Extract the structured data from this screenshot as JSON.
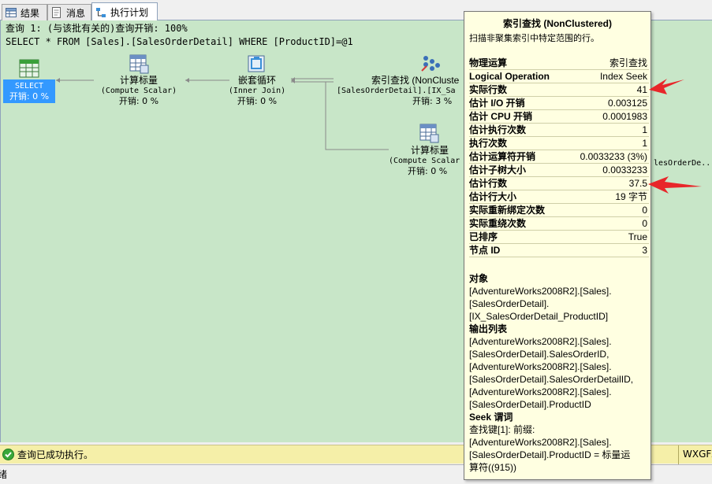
{
  "tabs": [
    {
      "label": "结果",
      "icon": "grid-icon"
    },
    {
      "label": "消息",
      "icon": "message-icon"
    },
    {
      "label": "执行计划",
      "icon": "plan-icon"
    }
  ],
  "query": {
    "header": "查询 1: (与该批有关的)查询开销: 100%",
    "sql": "SELECT * FROM [Sales].[SalesOrderDetail] WHERE [ProductID]=@1"
  },
  "plan": {
    "select": {
      "label": "SELECT",
      "cost": "开销: 0 %"
    },
    "compute1": {
      "name": "计算标量",
      "sub": "(Compute Scalar)",
      "cost": "开销: 0 %"
    },
    "nested": {
      "name": "嵌套循环",
      "sub": "(Inner Join)",
      "cost": "开销: 0 %"
    },
    "seek": {
      "name": "索引查找 (NonCluste",
      "sub": "[SalesOrderDetail].[IX_Sa",
      "cost": "开销: 3 %"
    },
    "compute2": {
      "name": "计算标量",
      "sub": "(Compute Scalar",
      "cost": "开销: 0 %"
    },
    "right_frag": "lesOrderDe..."
  },
  "tooltip": {
    "title": "索引查找 (NonClustered)",
    "description": "扫描非聚集索引中特定范围的行。",
    "rows": [
      {
        "label": "物理运算",
        "value": "索引查找"
      },
      {
        "label": "Logical Operation",
        "value": "Index Seek"
      },
      {
        "label": "实际行数",
        "value": "41"
      },
      {
        "label": "估计 I/O 开销",
        "value": "0.003125"
      },
      {
        "label": "估计 CPU 开销",
        "value": "0.0001983"
      },
      {
        "label": "估计执行次数",
        "value": "1"
      },
      {
        "label": "执行次数",
        "value": "1"
      },
      {
        "label": "估计运算符开销",
        "value": "0.0033233 (3%)"
      },
      {
        "label": "估计子树大小",
        "value": "0.0033233"
      },
      {
        "label": "估计行数",
        "value": "37.5"
      },
      {
        "label": "估计行大小",
        "value": "19 字节"
      },
      {
        "label": "实际重新绑定次数",
        "value": "0"
      },
      {
        "label": "实际重绕次数",
        "value": "0"
      },
      {
        "label": "已排序",
        "value": "True"
      },
      {
        "label": "节点 ID",
        "value": "3"
      }
    ],
    "object": {
      "heading": "对象",
      "lines": [
        "[AdventureWorks2008R2].[Sales].",
        "[SalesOrderDetail].",
        "[IX_SalesOrderDetail_ProductID]"
      ]
    },
    "output": {
      "heading": "输出列表",
      "lines": [
        "[AdventureWorks2008R2].[Sales].",
        "[SalesOrderDetail].SalesOrderID,",
        "[AdventureWorks2008R2].[Sales].",
        "[SalesOrderDetail].SalesOrderDetailID,",
        "[AdventureWorks2008R2].[Sales].",
        "[SalesOrderDetail].ProductID"
      ]
    },
    "seek_predicate": {
      "heading": "Seek 谓词",
      "lines": [
        "查找键[1]: 前缀:",
        "[AdventureWorks2008R2].[Sales].",
        "[SalesOrderDetail].ProductID = 标量运",
        "算符((915))"
      ]
    }
  },
  "status": {
    "message": "查询已成功执行。",
    "server": "WXGFZ",
    "bottom_fragment": "绪"
  },
  "colors": {
    "canvas": "#c8e6c8",
    "tooltip": "#ffffe1",
    "status": "#f5efa8",
    "selected": "#3399ff",
    "arrow": "#e8262a"
  }
}
